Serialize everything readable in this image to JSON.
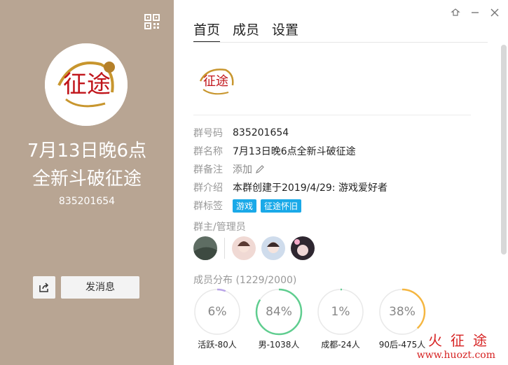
{
  "left": {
    "title_line1": "7月13日晚6点",
    "title_line2": "全新斗破征途",
    "group_id": "835201654",
    "send_message": "发消息",
    "avatar_text": "征途"
  },
  "tabs": [
    "首页",
    "成员",
    "设置"
  ],
  "info": {
    "group_no_label": "群号码",
    "group_no": "835201654",
    "name_label": "群名称",
    "name": "7月13日晚6点全新斗破征途",
    "remark_label": "群备注",
    "remark_add": "添加",
    "intro_label": "群介绍",
    "intro": "本群创建于2019/4/29:  游戏爱好者",
    "tags_label": "群标签",
    "tags": [
      "游戏",
      "征途怀旧"
    ]
  },
  "admins_label": "群主/管理员",
  "distribution_label": "成员分布 (1229/2000)",
  "stats": [
    {
      "value": "6%",
      "caption": "活跃-80人",
      "percent": 6,
      "color": "#b9a4e8"
    },
    {
      "value": "84%",
      "caption": "男-1038人",
      "percent": 84,
      "color": "#5fcd8f"
    },
    {
      "value": "1%",
      "caption": "成都-24人",
      "percent": 1,
      "color": "#5fcd8f"
    },
    {
      "value": "38%",
      "caption": "90后-475人",
      "percent": 38,
      "color": "#f5b640"
    }
  ],
  "watermark": {
    "title": "火征途",
    "url": "www.huozt.com"
  },
  "colors": {
    "left_bg": "#b8a593",
    "tag_bg": "#1aa9e8"
  }
}
